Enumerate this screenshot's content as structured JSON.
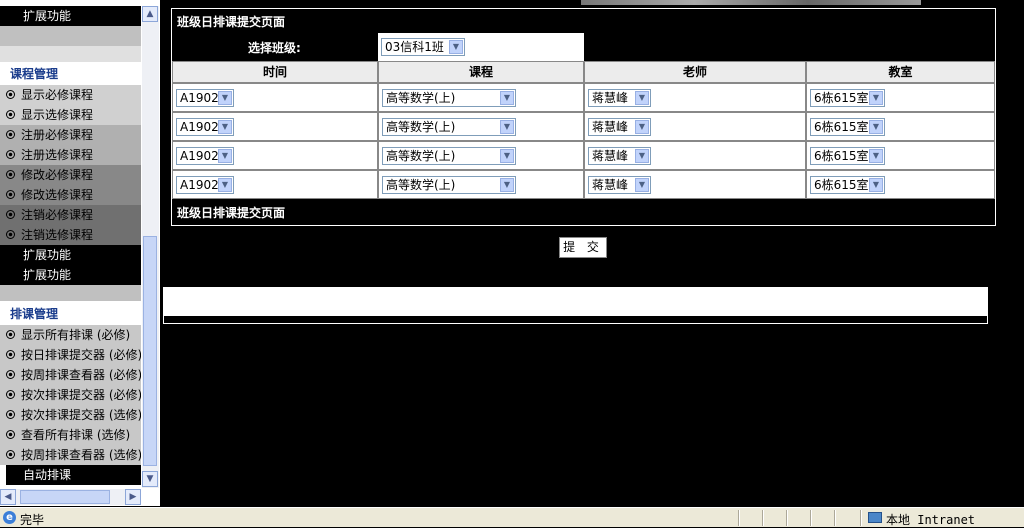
{
  "sidebar": {
    "top_item": "扩展功能",
    "section1": {
      "title": "课程管理",
      "items": [
        "显示必修课程",
        "显示选修课程",
        "注册必修课程",
        "注册选修课程",
        "修改必修课程",
        "修改选修课程",
        "注销必修课程",
        "注销选修课程"
      ],
      "extra": [
        "扩展功能",
        "扩展功能"
      ]
    },
    "section2": {
      "title": "排课管理",
      "items": [
        "显示所有排课 (必修)",
        "按日排课提交器 (必修)",
        "按周排课查看器 (必修)",
        "按次排课提交器 (必修)",
        "按次排课提交器 (选修)",
        "查看所有排课 (选修)",
        "按周排课查看器 (选修)"
      ],
      "extra": "自动排课"
    }
  },
  "form": {
    "title": "班级日排课提交页面",
    "class_label": "选择班级:",
    "class_value": "03信科1班",
    "headers": [
      "时间",
      "课程",
      "老师",
      "教室"
    ],
    "rows": [
      {
        "time": "A1902",
        "course": "高等数学(上)",
        "teacher": "蒋慧峰",
        "room": "6栋615室"
      },
      {
        "time": "A1902",
        "course": "高等数学(上)",
        "teacher": "蒋慧峰",
        "room": "6栋615室"
      },
      {
        "time": "A1902",
        "course": "高等数学(上)",
        "teacher": "蒋慧峰",
        "room": "6栋615室"
      },
      {
        "time": "A1902",
        "course": "高等数学(上)",
        "teacher": "蒋慧峰",
        "room": "6栋615室"
      }
    ],
    "footer": "班级日排课提交页面",
    "submit_label": "提 交"
  },
  "statusbar": {
    "status": "完毕",
    "zone": "本地 Intranet"
  },
  "icons": {
    "dropdown": "chevron-down-icon",
    "bullet": "radio-bullet-icon",
    "ie": "ie-page-icon",
    "zone": "intranet-zone-icon"
  }
}
